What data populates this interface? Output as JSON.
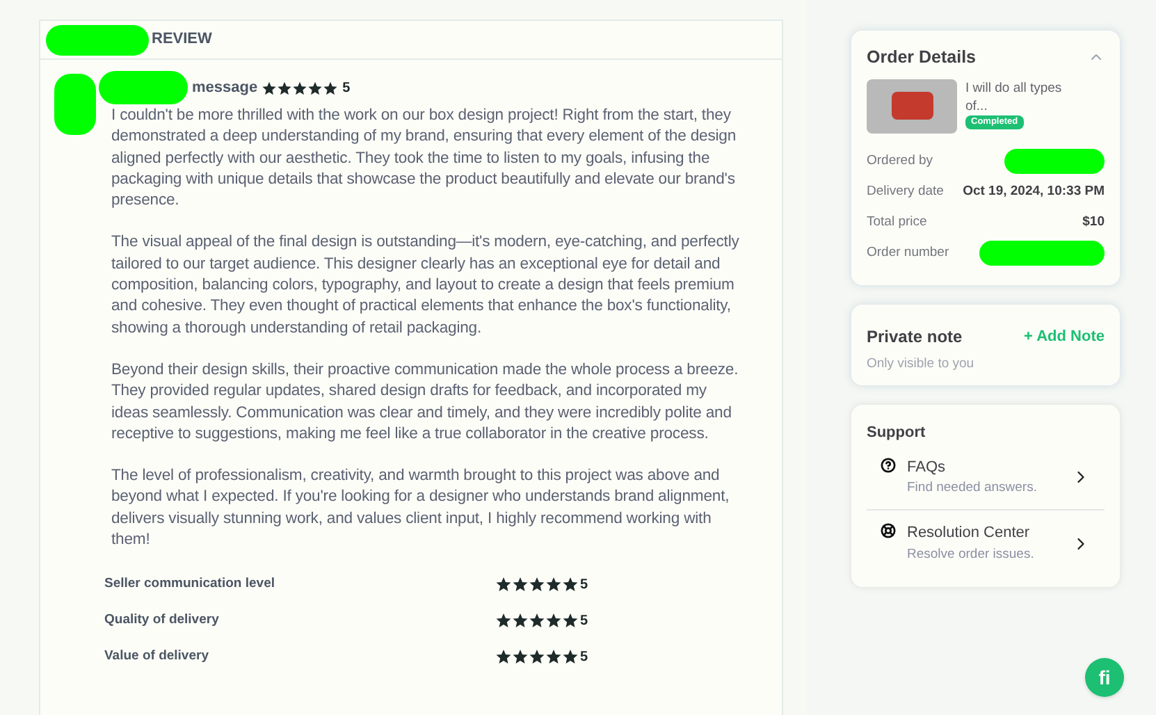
{
  "review": {
    "heading": "REVIEW",
    "label": "message",
    "stars": 5,
    "rating": "5",
    "paragraphs": [
      "I couldn't be more thrilled with the work on our box design project! Right from the start, they demonstrated a deep understanding of my brand, ensuring that every element of the design aligned perfectly with our aesthetic. They took the time to listen to my goals, infusing the packaging with unique details that showcase the product beautifully and elevate our brand's presence.",
      "The visual appeal of the final design is outstanding—it's modern, eye-catching, and perfectly tailored to our target audience. This designer clearly has an exceptional eye for detail and composition, balancing colors, typography, and layout to create a design that feels premium and cohesive. They even thought of practical elements that enhance the box's functionality, showing a thorough understanding of retail packaging.",
      "Beyond their design skills, their proactive communication made the whole process a breeze. They provided regular updates, shared design drafts for feedback, and incorporated my ideas seamlessly. Communication was clear and timely, and they were incredibly polite and receptive to suggestions, making me feel like a true collaborator in the creative process.",
      "The level of professionalism, creativity, and warmth brought to this project was above and beyond what I expected. If you're looking for a designer who understands brand alignment, delivers visually stunning work, and values client input, I highly recommend working with them!"
    ],
    "ratings": [
      {
        "label": "Seller communication level",
        "stars": 5,
        "value": "5"
      },
      {
        "label": "Quality of delivery",
        "stars": 5,
        "value": "5"
      },
      {
        "label": "Value of delivery",
        "stars": 5,
        "value": "5"
      }
    ]
  },
  "order_details": {
    "title": "Order Details",
    "expanded": true,
    "gig_title": "I will do all types of...",
    "status": "Completed",
    "fields": [
      {
        "label": "Ordered by",
        "kind": "hidden"
      },
      {
        "label": "Delivery date",
        "kind": "text",
        "value": "Oct 19, 2024, 10:33 PM"
      },
      {
        "label": "Total price",
        "kind": "text",
        "value": "$10"
      },
      {
        "label": "Order number",
        "kind": "hidden"
      }
    ]
  },
  "private_note": {
    "title": "Private note",
    "action": "+ Add Note",
    "hint": "Only visible to you"
  },
  "support": {
    "title": "Support",
    "items": [
      {
        "kind": "faq",
        "title": "FAQs",
        "subtitle": "Find needed answers."
      },
      {
        "kind": "resolution",
        "title": "Resolution Center",
        "subtitle": "Resolve order issues."
      }
    ]
  },
  "chat": {
    "label": "fi"
  }
}
